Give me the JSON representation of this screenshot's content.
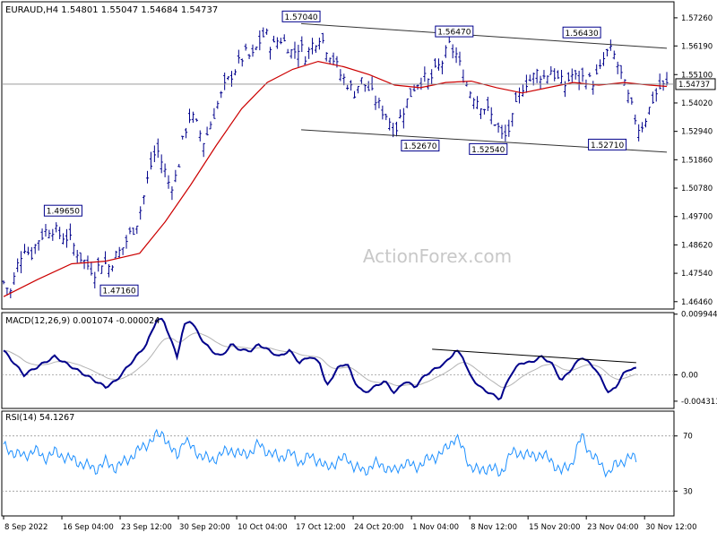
{
  "chart_data": [
    {
      "type": "candlestick",
      "header": {
        "symbol": "EURAUD,H4",
        "open": "1.54801",
        "high": "1.55047",
        "low": "1.54684",
        "close": "1.54737"
      },
      "last_price_tag": "1.54737",
      "watermark": "ActionForex.com",
      "y_range": [
        1.4618,
        1.5787
      ],
      "y_ticks": [
        "1.57260",
        "1.56190",
        "1.55100",
        "1.54020",
        "1.52940",
        "1.51860",
        "1.50780",
        "1.49700",
        "1.48620",
        "1.47540",
        "1.46460"
      ],
      "close_path": [
        [
          0,
          1.472
        ],
        [
          4,
          1.468
        ],
        [
          8,
          1.478
        ],
        [
          12,
          1.486
        ],
        [
          16,
          1.482
        ],
        [
          20,
          1.488
        ],
        [
          24,
          1.491
        ],
        [
          28,
          1.493
        ],
        [
          33,
          1.49
        ],
        [
          38,
          1.489
        ],
        [
          42,
          1.485
        ],
        [
          46,
          1.481
        ],
        [
          50,
          1.478
        ],
        [
          54,
          1.476
        ],
        [
          58,
          1.48
        ],
        [
          62,
          1.478
        ],
        [
          66,
          1.482
        ],
        [
          70,
          1.485
        ],
        [
          74,
          1.49
        ],
        [
          78,
          1.494
        ],
        [
          82,
          1.503
        ],
        [
          86,
          1.515
        ],
        [
          90,
          1.523
        ],
        [
          94,
          1.516
        ],
        [
          98,
          1.508
        ],
        [
          102,
          1.513
        ],
        [
          106,
          1.528
        ],
        [
          110,
          1.536
        ],
        [
          114,
          1.531
        ],
        [
          118,
          1.525
        ],
        [
          122,
          1.533
        ],
        [
          126,
          1.54
        ],
        [
          130,
          1.546
        ],
        [
          134,
          1.551
        ],
        [
          138,
          1.555
        ],
        [
          142,
          1.559
        ],
        [
          146,
          1.557
        ],
        [
          150,
          1.563
        ],
        [
          154,
          1.567
        ],
        [
          158,
          1.561
        ],
        [
          162,
          1.565
        ],
        [
          166,
          1.563
        ],
        [
          170,
          1.559
        ],
        [
          174,
          1.562
        ],
        [
          178,
          1.558
        ],
        [
          182,
          1.563
        ],
        [
          186,
          1.566
        ],
        [
          190,
          1.561
        ],
        [
          194,
          1.557
        ],
        [
          198,
          1.551
        ],
        [
          202,
          1.548
        ],
        [
          206,
          1.544
        ],
        [
          210,
          1.549
        ],
        [
          214,
          1.546
        ],
        [
          218,
          1.542
        ],
        [
          222,
          1.538
        ],
        [
          226,
          1.535
        ],
        [
          230,
          1.529
        ],
        [
          234,
          1.536
        ],
        [
          238,
          1.542
        ],
        [
          242,
          1.547
        ],
        [
          246,
          1.55
        ],
        [
          250,
          1.548
        ],
        [
          254,
          1.552
        ],
        [
          258,
          1.556
        ],
        [
          262,
          1.562
        ],
        [
          266,
          1.559
        ],
        [
          270,
          1.551
        ],
        [
          274,
          1.545
        ],
        [
          278,
          1.542
        ],
        [
          282,
          1.539
        ],
        [
          286,
          1.536
        ],
        [
          290,
          1.532
        ],
        [
          294,
          1.526
        ],
        [
          298,
          1.531
        ],
        [
          302,
          1.54
        ],
        [
          306,
          1.548
        ],
        [
          310,
          1.549
        ],
        [
          314,
          1.552
        ],
        [
          318,
          1.55
        ],
        [
          322,
          1.553
        ],
        [
          326,
          1.549
        ],
        [
          330,
          1.547
        ],
        [
          334,
          1.551
        ],
        [
          338,
          1.549
        ],
        [
          342,
          1.55
        ],
        [
          346,
          1.548
        ],
        [
          350,
          1.551
        ],
        [
          354,
          1.559
        ],
        [
          358,
          1.56
        ],
        [
          362,
          1.553
        ],
        [
          366,
          1.545
        ],
        [
          370,
          1.537
        ],
        [
          374,
          1.53
        ],
        [
          378,
          1.535
        ],
        [
          382,
          1.542
        ],
        [
          386,
          1.546
        ],
        [
          390,
          1.547
        ]
      ],
      "ema_path": [
        [
          0,
          1.4665
        ],
        [
          20,
          1.473
        ],
        [
          40,
          1.479
        ],
        [
          60,
          1.48
        ],
        [
          80,
          1.483
        ],
        [
          95,
          1.495
        ],
        [
          110,
          1.509
        ],
        [
          125,
          1.524
        ],
        [
          140,
          1.538
        ],
        [
          155,
          1.548
        ],
        [
          170,
          1.553
        ],
        [
          185,
          1.556
        ],
        [
          200,
          1.554
        ],
        [
          215,
          1.551
        ],
        [
          230,
          1.547
        ],
        [
          245,
          1.546
        ],
        [
          260,
          1.548
        ],
        [
          275,
          1.5485
        ],
        [
          290,
          1.546
        ],
        [
          305,
          1.544
        ],
        [
          320,
          1.546
        ],
        [
          335,
          1.548
        ],
        [
          350,
          1.547
        ],
        [
          365,
          1.548
        ],
        [
          380,
          1.547
        ],
        [
          390,
          1.5465
        ]
      ],
      "channel": {
        "upper": [
          [
            175,
            1.5704
          ],
          [
            390,
            1.561
          ]
        ],
        "lower": [
          [
            175,
            1.53
          ],
          [
            390,
            1.5215
          ]
        ]
      },
      "price_labels": [
        {
          "text": "1.57040",
          "x": 175,
          "y": 1.5704,
          "pos": "above"
        },
        {
          "text": "1.56470",
          "x": 265,
          "y": 1.5647,
          "pos": "above"
        },
        {
          "text": "1.56430",
          "x": 340,
          "y": 1.5643,
          "pos": "above"
        },
        {
          "text": "1.49650",
          "x": 35,
          "y": 1.4965,
          "pos": "above"
        },
        {
          "text": "1.47160",
          "x": 68,
          "y": 1.4716,
          "pos": "below"
        },
        {
          "text": "1.52670",
          "x": 245,
          "y": 1.5267,
          "pos": "below"
        },
        {
          "text": "1.52540",
          "x": 285,
          "y": 1.5254,
          "pos": "below"
        },
        {
          "text": "1.52710",
          "x": 355,
          "y": 1.5271,
          "pos": "below"
        }
      ]
    },
    {
      "type": "line",
      "label": "MACD(12,26,9) 0.001074 -0.000024",
      "y_range": [
        -0.0055,
        0.0102
      ],
      "y_ticks": [
        "0.009944",
        "0.00",
        "-0.004313"
      ],
      "macd_path": [
        [
          0,
          0.004
        ],
        [
          6,
          0.002
        ],
        [
          12,
          0.0
        ],
        [
          18,
          0.001
        ],
        [
          24,
          0.002
        ],
        [
          30,
          0.003
        ],
        [
          36,
          0.002
        ],
        [
          42,
          0.001
        ],
        [
          48,
          0.0
        ],
        [
          54,
          -0.001
        ],
        [
          60,
          -0.002
        ],
        [
          66,
          -0.001
        ],
        [
          72,
          0.001
        ],
        [
          78,
          0.003
        ],
        [
          84,
          0.005
        ],
        [
          90,
          0.009
        ],
        [
          94,
          0.009
        ],
        [
          98,
          0.006
        ],
        [
          102,
          0.003
        ],
        [
          106,
          0.008
        ],
        [
          110,
          0.009
        ],
        [
          116,
          0.006
        ],
        [
          122,
          0.004
        ],
        [
          128,
          0.003
        ],
        [
          134,
          0.005
        ],
        [
          140,
          0.004
        ],
        [
          146,
          0.004
        ],
        [
          150,
          0.005
        ],
        [
          156,
          0.004
        ],
        [
          162,
          0.003
        ],
        [
          168,
          0.004
        ],
        [
          174,
          0.002
        ],
        [
          180,
          0.003
        ],
        [
          186,
          0.002
        ],
        [
          190,
          -0.002
        ],
        [
          196,
          0.001
        ],
        [
          202,
          0.002
        ],
        [
          206,
          -0.001
        ],
        [
          212,
          -0.003
        ],
        [
          218,
          -0.002
        ],
        [
          224,
          -0.001
        ],
        [
          230,
          -0.003
        ],
        [
          236,
          -0.001
        ],
        [
          242,
          -0.002
        ],
        [
          248,
          0.0
        ],
        [
          254,
          0.001
        ],
        [
          260,
          0.002
        ],
        [
          266,
          0.004
        ],
        [
          270,
          0.003
        ],
        [
          274,
          0.0
        ],
        [
          280,
          -0.002
        ],
        [
          286,
          -0.003
        ],
        [
          292,
          -0.004
        ],
        [
          298,
          0.0
        ],
        [
          304,
          0.002
        ],
        [
          310,
          0.002
        ],
        [
          316,
          0.003
        ],
        [
          322,
          0.002
        ],
        [
          328,
          -0.001
        ],
        [
          334,
          0.001
        ],
        [
          340,
          0.003
        ],
        [
          344,
          0.002
        ],
        [
          348,
          0.001
        ],
        [
          352,
          -0.001
        ],
        [
          356,
          -0.003
        ],
        [
          360,
          -0.002
        ],
        [
          364,
          0.0
        ],
        [
          368,
          0.001
        ],
        [
          372,
          0.001
        ]
      ],
      "trendline": [
        [
          252,
          0.0042
        ],
        [
          372,
          0.002
        ]
      ]
    },
    {
      "type": "line",
      "label": "RSI(14) 54.1267",
      "y_range": [
        12,
        88
      ],
      "y_ticks": [
        "70",
        "30"
      ],
      "levels": [
        70,
        30
      ],
      "rsi_path": [
        [
          0,
          62
        ],
        [
          6,
          58
        ],
        [
          12,
          55
        ],
        [
          18,
          60
        ],
        [
          24,
          54
        ],
        [
          30,
          58
        ],
        [
          36,
          55
        ],
        [
          42,
          52
        ],
        [
          48,
          49
        ],
        [
          54,
          46
        ],
        [
          60,
          51
        ],
        [
          66,
          47
        ],
        [
          72,
          52
        ],
        [
          78,
          58
        ],
        [
          84,
          64
        ],
        [
          90,
          70
        ],
        [
          94,
          72
        ],
        [
          98,
          61
        ],
        [
          102,
          55
        ],
        [
          106,
          68
        ],
        [
          110,
          62
        ],
        [
          116,
          56
        ],
        [
          122,
          52
        ],
        [
          128,
          57
        ],
        [
          134,
          60
        ],
        [
          140,
          56
        ],
        [
          146,
          59
        ],
        [
          150,
          64
        ],
        [
          156,
          58
        ],
        [
          162,
          54
        ],
        [
          168,
          58
        ],
        [
          174,
          51
        ],
        [
          180,
          55
        ],
        [
          186,
          52
        ],
        [
          190,
          46
        ],
        [
          196,
          52
        ],
        [
          202,
          54
        ],
        [
          206,
          48
        ],
        [
          212,
          44
        ],
        [
          218,
          50
        ],
        [
          224,
          48
        ],
        [
          230,
          44
        ],
        [
          236,
          51
        ],
        [
          242,
          47
        ],
        [
          248,
          52
        ],
        [
          254,
          55
        ],
        [
          260,
          60
        ],
        [
          266,
          70
        ],
        [
          270,
          60
        ],
        [
          274,
          49
        ],
        [
          280,
          44
        ],
        [
          286,
          48
        ],
        [
          292,
          42
        ],
        [
          298,
          57
        ],
        [
          304,
          58
        ],
        [
          310,
          55
        ],
        [
          316,
          57
        ],
        [
          322,
          52
        ],
        [
          328,
          44
        ],
        [
          334,
          50
        ],
        [
          340,
          70
        ],
        [
          344,
          60
        ],
        [
          348,
          53
        ],
        [
          352,
          48
        ],
        [
          356,
          43
        ],
        [
          360,
          49
        ],
        [
          364,
          52
        ],
        [
          368,
          54
        ],
        [
          372,
          54
        ]
      ]
    }
  ],
  "x_axis_labels": [
    "8 Sep 2022",
    "16 Sep 04:00",
    "23 Sep 12:00",
    "30 Sep 20:00",
    "10 Oct 04:00",
    "17 Oct 12:00",
    "24 Oct 20:00",
    "1 Nov 04:00",
    "8 Nov 12:00",
    "15 Nov 20:00",
    "23 Nov 04:00",
    "30 Nov 12:00"
  ],
  "colors": {
    "bars": "#00008b",
    "ema": "#cc0000",
    "macd": "#00008b",
    "signal": "#b4b4b4",
    "rsi": "#1e90ff",
    "channel": "#333333",
    "grid": "#9a9a9a"
  }
}
